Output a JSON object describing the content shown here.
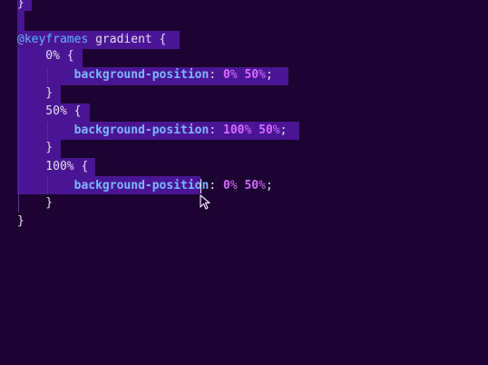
{
  "editor": {
    "lines": [
      {
        "id": "l0",
        "tokens": [
          {
            "t": "}",
            "c": "tok-punct"
          }
        ]
      },
      {
        "id": "l1",
        "tokens": [
          {
            "t": "@keyframes",
            "c": "tok-at"
          },
          {
            "t": " gradient {",
            "c": "tok-plain"
          }
        ]
      },
      {
        "id": "l2",
        "tokens": [
          {
            "t": "    0% {",
            "c": "tok-plain"
          }
        ]
      },
      {
        "id": "l3",
        "tokens": [
          {
            "t": "        ",
            "c": "tok-plain"
          },
          {
            "t": "background-position",
            "c": "tok-prop"
          },
          {
            "t": ": ",
            "c": "tok-plain"
          },
          {
            "t": "0",
            "c": "tok-num"
          },
          {
            "t": "%",
            "c": "tok-pct"
          },
          {
            "t": " ",
            "c": "tok-plain"
          },
          {
            "t": "50",
            "c": "tok-num"
          },
          {
            "t": "%",
            "c": "tok-pct"
          },
          {
            "t": ";",
            "c": "tok-punct"
          }
        ]
      },
      {
        "id": "l4",
        "tokens": [
          {
            "t": "    }",
            "c": "tok-plain"
          }
        ]
      },
      {
        "id": "l5",
        "tokens": [
          {
            "t": "    50% {",
            "c": "tok-plain"
          }
        ]
      },
      {
        "id": "l6",
        "tokens": [
          {
            "t": "        ",
            "c": "tok-plain"
          },
          {
            "t": "background-position",
            "c": "tok-prop"
          },
          {
            "t": ": ",
            "c": "tok-plain"
          },
          {
            "t": "100",
            "c": "tok-num"
          },
          {
            "t": "%",
            "c": "tok-pct"
          },
          {
            "t": " ",
            "c": "tok-plain"
          },
          {
            "t": "50",
            "c": "tok-num"
          },
          {
            "t": "%",
            "c": "tok-pct"
          },
          {
            "t": ";",
            "c": "tok-punct"
          }
        ]
      },
      {
        "id": "l7",
        "tokens": [
          {
            "t": "    }",
            "c": "tok-plain"
          }
        ]
      },
      {
        "id": "l8",
        "tokens": [
          {
            "t": "    100% {",
            "c": "tok-plain"
          }
        ]
      },
      {
        "id": "l9",
        "tokens": [
          {
            "t": "        ",
            "c": "tok-plain"
          },
          {
            "t": "background-position",
            "c": "tok-prop"
          },
          {
            "t": ": ",
            "c": "tok-plain"
          },
          {
            "t": "0",
            "c": "tok-num"
          },
          {
            "t": "%",
            "c": "tok-pct"
          },
          {
            "t": " ",
            "c": "tok-plain"
          },
          {
            "t": "50",
            "c": "tok-num"
          },
          {
            "t": "%",
            "c": "tok-pct"
          },
          {
            "t": ";",
            "c": "tok-punct"
          }
        ]
      },
      {
        "id": "l10",
        "tokens": [
          {
            "t": "    }",
            "c": "tok-plain"
          }
        ]
      },
      {
        "id": "l11",
        "tokens": [
          {
            "t": "}",
            "c": "tok-punct"
          }
        ]
      }
    ],
    "colors": {
      "background": "#1c0331",
      "selection": "#4a1594",
      "at_rule": "#5fb3ff",
      "property": "#7fb6ff",
      "number": "#d66bff"
    },
    "cursor_icon": "mouse-pointer-icon"
  }
}
